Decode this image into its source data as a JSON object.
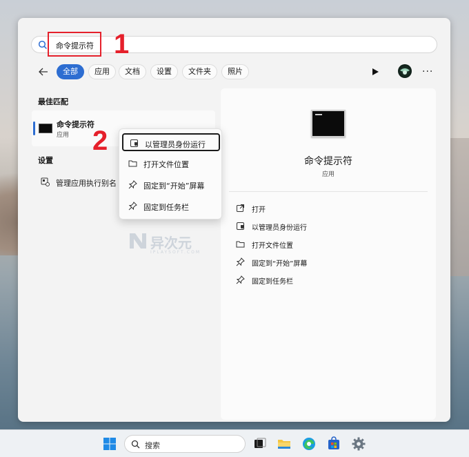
{
  "search": {
    "query": "命令提示符"
  },
  "annotations": {
    "step1": "1",
    "step2": "2"
  },
  "tabs": [
    {
      "label": "全部",
      "active": true
    },
    {
      "label": "应用"
    },
    {
      "label": "文档"
    },
    {
      "label": "设置"
    },
    {
      "label": "文件夹"
    },
    {
      "label": "照片"
    }
  ],
  "best_match": {
    "section_title": "最佳匹配",
    "title": "命令提示符",
    "subtitle": "应用"
  },
  "settings": {
    "section_title": "设置",
    "item_label": "管理应用执行别名"
  },
  "context_menu": {
    "items": [
      {
        "label": "以管理员身份运行",
        "icon": "shield-icon"
      },
      {
        "label": "打开文件位置",
        "icon": "folder-icon"
      },
      {
        "label": "固定到“开始”屏幕",
        "icon": "pin-icon"
      },
      {
        "label": "固定到任务栏",
        "icon": "pin-icon"
      }
    ]
  },
  "preview": {
    "title": "命令提示符",
    "subtitle": "应用",
    "actions": [
      {
        "label": "打开",
        "icon": "open-external-icon"
      },
      {
        "label": "以管理员身份运行",
        "icon": "shield-icon"
      },
      {
        "label": "打开文件位置",
        "icon": "folder-icon"
      },
      {
        "label": "固定到“开始”屏幕",
        "icon": "pin-icon"
      },
      {
        "label": "固定到任务栏",
        "icon": "pin-icon"
      }
    ]
  },
  "watermark": {
    "title": "异次元",
    "subtitle": "IPLAYSOFT.COM"
  },
  "taskbar": {
    "search_placeholder": "搜索"
  },
  "colors": {
    "accent": "#2d6dd1",
    "annotation_red": "#e5202b"
  }
}
